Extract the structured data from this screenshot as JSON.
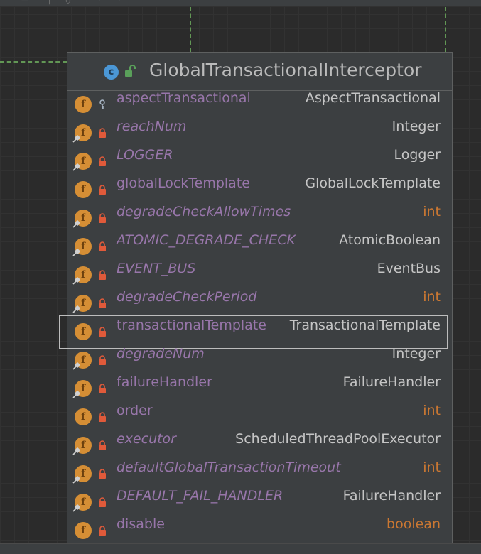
{
  "diagram": {
    "class_name": "GlobalTransactionalInterceptor",
    "class_icon": "class-c-icon",
    "visibility_icon": "unlock-icon",
    "fields": [
      {
        "name": "aspectTransactional",
        "type": "AspectTransactional",
        "italic": false,
        "static": false,
        "modifier_icon": "key-icon",
        "type_kind": "class"
      },
      {
        "name": "reachNum",
        "type": "Integer",
        "italic": true,
        "static": true,
        "modifier_icon": "lock-icon",
        "type_kind": "class"
      },
      {
        "name": "LOGGER",
        "type": "Logger",
        "italic": true,
        "static": true,
        "modifier_icon": "lock-icon",
        "type_kind": "class"
      },
      {
        "name": "globalLockTemplate",
        "type": "GlobalLockTemplate",
        "italic": false,
        "static": false,
        "modifier_icon": "lock-icon",
        "type_kind": "class"
      },
      {
        "name": "degradeCheckAllowTimes",
        "type": "int",
        "italic": true,
        "static": true,
        "modifier_icon": "lock-icon",
        "type_kind": "primitive"
      },
      {
        "name": "ATOMIC_DEGRADE_CHECK",
        "type": "AtomicBoolean",
        "italic": true,
        "static": true,
        "modifier_icon": "lock-icon",
        "type_kind": "class"
      },
      {
        "name": "EVENT_BUS",
        "type": "EventBus",
        "italic": true,
        "static": true,
        "modifier_icon": "lock-icon",
        "type_kind": "class"
      },
      {
        "name": "degradeCheckPeriod",
        "type": "int",
        "italic": true,
        "static": true,
        "modifier_icon": "lock-icon",
        "type_kind": "primitive"
      },
      {
        "name": "transactionalTemplate",
        "type": "TransactionalTemplate",
        "italic": false,
        "static": false,
        "modifier_icon": "lock-icon",
        "type_kind": "class",
        "selected": true
      },
      {
        "name": "degradeNum",
        "type": "Integer",
        "italic": true,
        "static": true,
        "modifier_icon": "lock-icon",
        "type_kind": "class"
      },
      {
        "name": "failureHandler",
        "type": "FailureHandler",
        "italic": false,
        "static": true,
        "modifier_icon": "lock-icon",
        "type_kind": "class"
      },
      {
        "name": "order",
        "type": "int",
        "italic": false,
        "static": false,
        "modifier_icon": "lock-icon",
        "type_kind": "primitive"
      },
      {
        "name": "executor",
        "type": "ScheduledThreadPoolExecutor",
        "italic": true,
        "static": true,
        "modifier_icon": "lock-icon",
        "type_kind": "class"
      },
      {
        "name": "defaultGlobalTransactionTimeout",
        "type": "int",
        "italic": true,
        "static": true,
        "modifier_icon": "lock-icon",
        "type_kind": "primitive"
      },
      {
        "name": "DEFAULT_FAIL_HANDLER",
        "type": "FailureHandler",
        "italic": true,
        "static": true,
        "modifier_icon": "lock-icon",
        "type_kind": "class"
      },
      {
        "name": "disable",
        "type": "boolean",
        "italic": false,
        "static": false,
        "modifier_icon": "lock-icon",
        "type_kind": "primitive"
      }
    ]
  },
  "colors": {
    "background": "#2b2b2b",
    "node_background": "#3c3f41",
    "field_name": "#9876aa",
    "type_name": "#c5c5c5",
    "primitive_type": "#cc7832",
    "field_icon": "#d58e35",
    "class_icon": "#4b97d6",
    "selection_border": "#bdbdbd",
    "connector": "#629755"
  }
}
